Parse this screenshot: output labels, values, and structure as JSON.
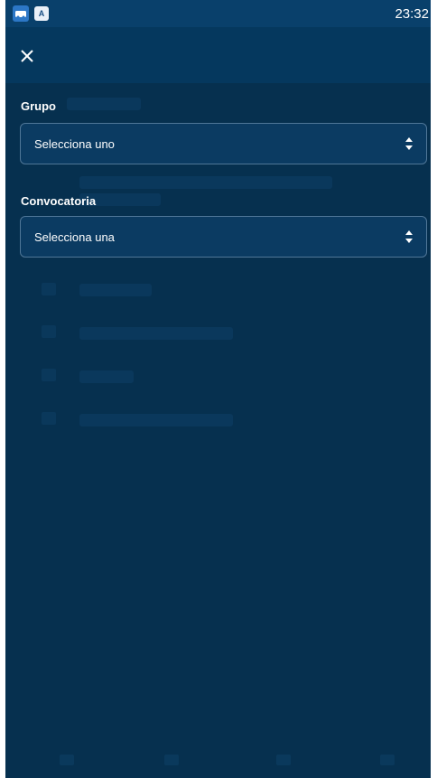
{
  "status_bar": {
    "app_icon_1": "notification-app-icon",
    "app_icon_2": "A",
    "time": "23:32"
  },
  "header": {
    "close_icon": "close-icon"
  },
  "filters": {
    "group": {
      "label": "Grupo",
      "value": "Selecciona uno"
    },
    "call": {
      "label": "Convocatoria",
      "value": "Selecciona una"
    }
  },
  "colors": {
    "background": "#06304f",
    "status_bar": "#09406b",
    "field_border": "#4f7697",
    "text": "#ffffff"
  }
}
